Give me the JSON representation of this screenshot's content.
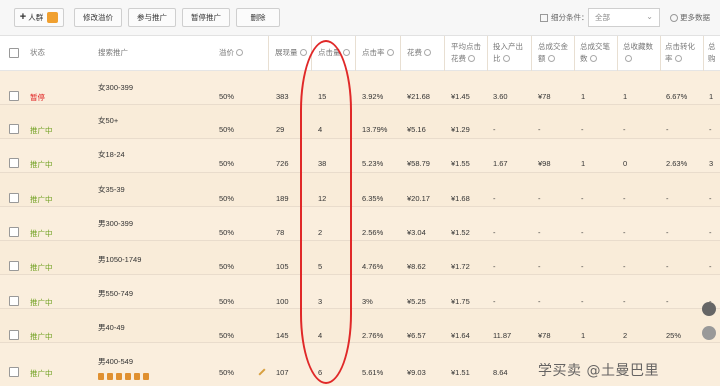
{
  "toolbar": {
    "add_label": "人群",
    "modify_price_label": "修改溢价",
    "join_promo_label": "参与推广",
    "pause_promo_label": "暂停推广",
    "delete_label": "删除",
    "filter_label": "细分条件：",
    "filter_value": "全部",
    "more_data_label": "更多数据"
  },
  "columns": {
    "status": "状态",
    "search_promo": "搜索推广",
    "premium": "溢价",
    "impressions": "展现量",
    "clicks": "点击量",
    "ctr": "点击率",
    "cost": "花费",
    "avg_cpc_1": "平均点击",
    "avg_cpc_2": "花费",
    "roi_1": "投入产出",
    "roi_2": "比",
    "total_gmv_1": "总成交金",
    "total_gmv_2": "额",
    "total_orders_1": "总成交笔",
    "total_orders_2": "数",
    "total_fav_1": "总收藏数",
    "conv_rate_1": "点击转化",
    "conv_rate_2": "率",
    "last_1": "总购"
  },
  "rows": [
    {
      "status": "暂停",
      "status_type": "paused",
      "keyword": "女300-399",
      "premium": "50%",
      "impressions": "383",
      "clicks": "15",
      "ctr": "3.92%",
      "cost": "¥21.68",
      "cpc": "¥1.45",
      "roi": "3.60",
      "gmv": "¥78",
      "orders": "1",
      "fav": "1",
      "conv": "6.67%",
      "last": "1"
    },
    {
      "status": "推广中",
      "status_type": "active",
      "keyword": "女50+",
      "premium": "50%",
      "impressions": "29",
      "clicks": "4",
      "ctr": "13.79%",
      "cost": "¥5.16",
      "cpc": "¥1.29",
      "roi": "-",
      "gmv": "-",
      "orders": "-",
      "fav": "-",
      "conv": "-",
      "last": "-"
    },
    {
      "status": "推广中",
      "status_type": "active",
      "keyword": "女18-24",
      "premium": "50%",
      "impressions": "726",
      "clicks": "38",
      "ctr": "5.23%",
      "cost": "¥58.79",
      "cpc": "¥1.55",
      "roi": "1.67",
      "gmv": "¥98",
      "orders": "1",
      "fav": "0",
      "conv": "2.63%",
      "last": "3"
    },
    {
      "status": "推广中",
      "status_type": "active",
      "keyword": "女35-39",
      "premium": "50%",
      "impressions": "189",
      "clicks": "12",
      "ctr": "6.35%",
      "cost": "¥20.17",
      "cpc": "¥1.68",
      "roi": "-",
      "gmv": "-",
      "orders": "-",
      "fav": "-",
      "conv": "-",
      "last": "-"
    },
    {
      "status": "推广中",
      "status_type": "active",
      "keyword": "男300-399",
      "premium": "50%",
      "impressions": "78",
      "clicks": "2",
      "ctr": "2.56%",
      "cost": "¥3.04",
      "cpc": "¥1.52",
      "roi": "-",
      "gmv": "-",
      "orders": "-",
      "fav": "-",
      "conv": "-",
      "last": "-"
    },
    {
      "status": "推广中",
      "status_type": "active",
      "keyword": "男1050-1749",
      "premium": "50%",
      "impressions": "105",
      "clicks": "5",
      "ctr": "4.76%",
      "cost": "¥8.62",
      "cpc": "¥1.72",
      "roi": "-",
      "gmv": "-",
      "orders": "-",
      "fav": "-",
      "conv": "-",
      "last": "-"
    },
    {
      "status": "推广中",
      "status_type": "active",
      "keyword": "男550-749",
      "premium": "50%",
      "impressions": "100",
      "clicks": "3",
      "ctr": "3%",
      "cost": "¥5.25",
      "cpc": "¥1.75",
      "roi": "-",
      "gmv": "-",
      "orders": "-",
      "fav": "-",
      "conv": "-",
      "last": "-"
    },
    {
      "status": "推广中",
      "status_type": "active",
      "keyword": "男40-49",
      "premium": "50%",
      "impressions": "145",
      "clicks": "4",
      "ctr": "2.76%",
      "cost": "¥6.57",
      "cpc": "¥1.64",
      "roi": "11.87",
      "gmv": "¥78",
      "orders": "1",
      "fav": "2",
      "conv": "25%",
      "last": ""
    },
    {
      "status": "推广中",
      "status_type": "active",
      "keyword": "男400-549",
      "premium": "50%",
      "impressions": "107",
      "clicks": "6",
      "ctr": "5.61%",
      "cost": "¥9.03",
      "cpc": "¥1.51",
      "roi": "8.64",
      "gmv": "",
      "orders": "",
      "fav": "",
      "conv": "",
      "last": ""
    }
  ],
  "watermark": "学买卖 @土曼巴里",
  "colors": {
    "paused": "#e02020",
    "active": "#6fa020",
    "highlight_oval": "#e02828",
    "row_bg": "#f9ecd9"
  }
}
